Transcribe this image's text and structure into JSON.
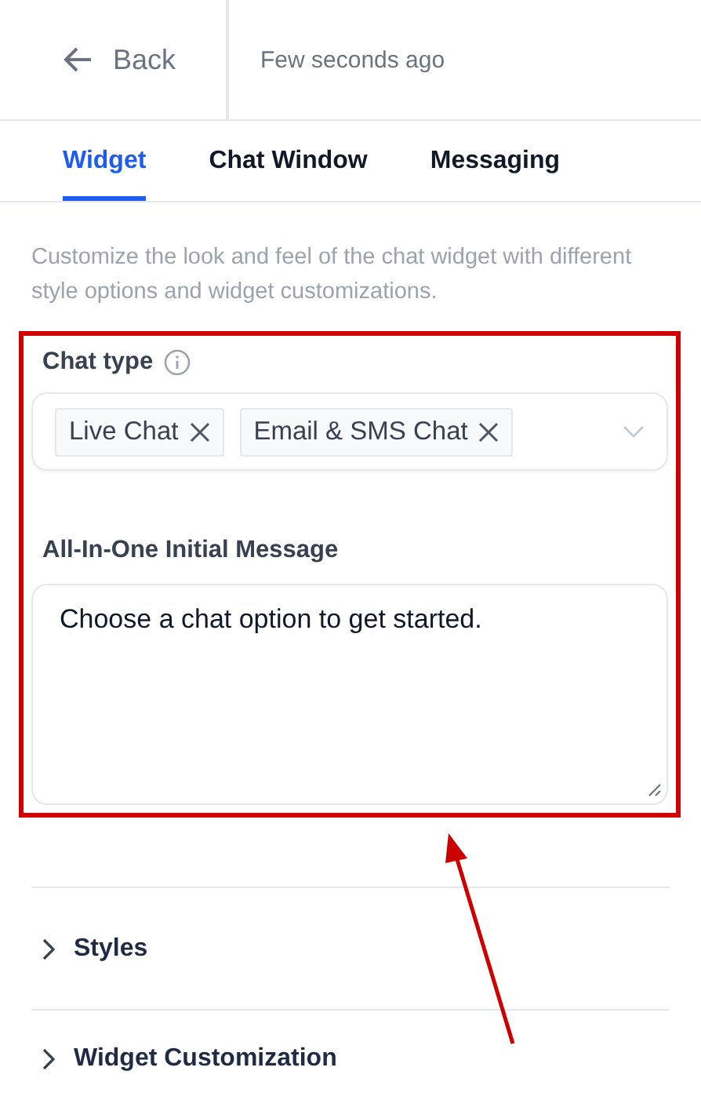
{
  "header": {
    "back": "Back",
    "status": "Few seconds ago"
  },
  "tabs": [
    {
      "label": "Widget",
      "selected": true
    },
    {
      "label": "Chat Window",
      "selected": false
    },
    {
      "label": "Messaging",
      "selected": false
    }
  ],
  "description": "Customize the look and feel of the chat widget with different style options and widget customizations.",
  "chat_type": {
    "label": "Chat type",
    "tags": [
      "Live Chat",
      "Email & SMS Chat"
    ]
  },
  "initial_message": {
    "label": "All-In-One Initial Message",
    "value": "Choose a chat option to get started."
  },
  "sections": [
    {
      "label": "Styles",
      "expanded": false
    },
    {
      "label": "Widget Customization",
      "expanded": false
    }
  ]
}
